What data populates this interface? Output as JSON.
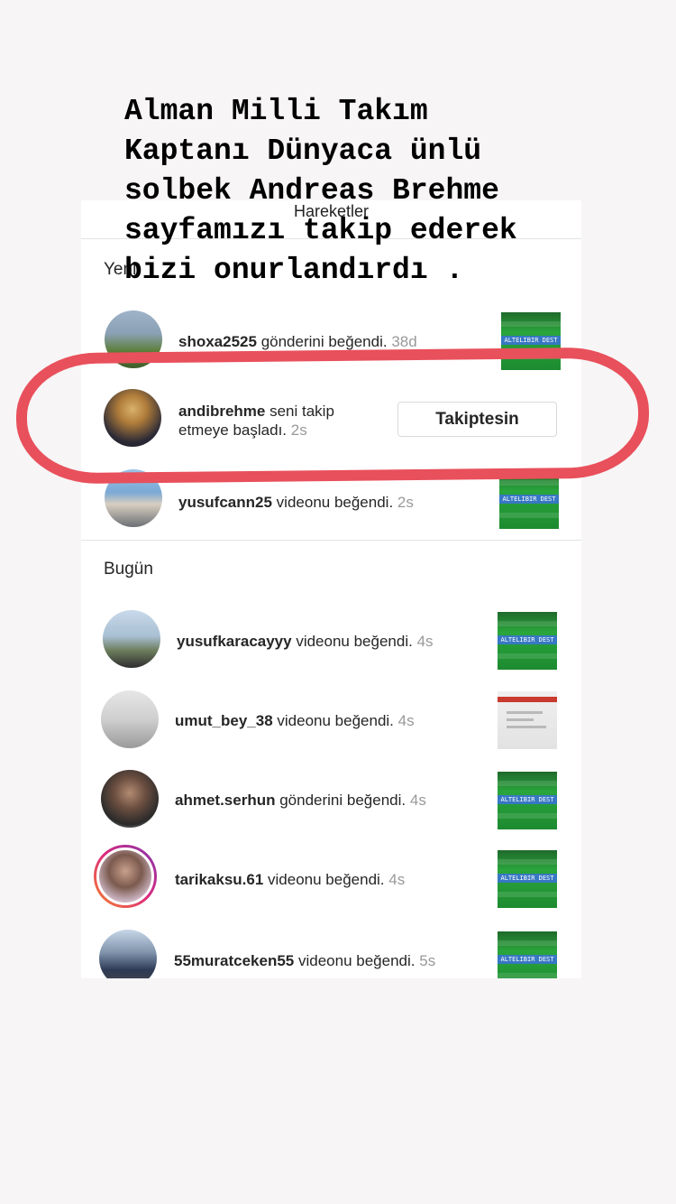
{
  "screen": {
    "title": "Hareketler",
    "sections": {
      "new": "Yeni",
      "today": "Bugün"
    }
  },
  "caption": "Alman Milli Takım\nKaptanı Dünyaca ünlü\nsolbek Andreas Brehme\nsayfamızı takip ederek\nbizi onurlandırdı .",
  "notifications_new": [
    {
      "username": "shoxa2525",
      "action": "gönderini beğendi.",
      "time": "38d"
    },
    {
      "username": "andibrehme",
      "action_line1": "seni takip",
      "action_line2": "etmeye başladı.",
      "time": "2s",
      "button": "Takiptesin"
    },
    {
      "username": "yusufcann25",
      "action": "videonu beğendi.",
      "time": "2s"
    }
  ],
  "notifications_today": [
    {
      "username": "yusufkaracayyy",
      "action": "videonu beğendi.",
      "time": "4s"
    },
    {
      "username": "umut_bey_38",
      "action": "videonu beğendi.",
      "time": "4s"
    },
    {
      "username": "ahmet.serhun",
      "action": "gönderini beğendi.",
      "time": "4s"
    },
    {
      "username": "tarikaksu.61",
      "action": "videonu beğendi.",
      "time": "4s"
    },
    {
      "username": "55muratceken55",
      "action": "videonu beğendi.",
      "time": "5s"
    }
  ],
  "thumb_band_text": "ALTELIBIR DEST",
  "colors": {
    "highlight": "#e8505b",
    "time_gray": "#999999",
    "story_bg": "#f7f5f6"
  }
}
